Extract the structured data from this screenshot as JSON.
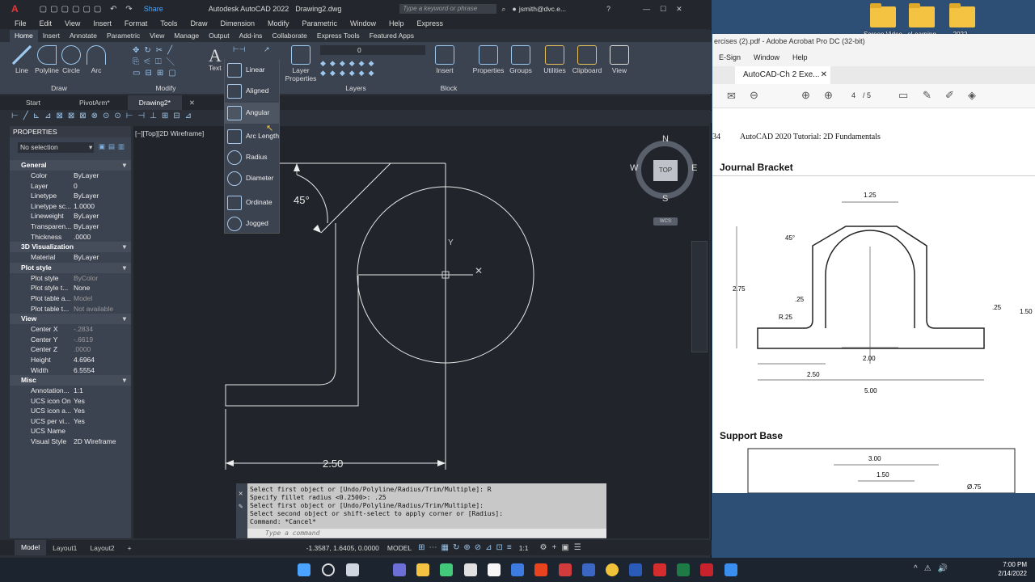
{
  "desktop": {
    "icons": [
      "Screen Video",
      "eLearning",
      "2022 -"
    ]
  },
  "acad": {
    "title": "Autodesk AutoCAD 2022",
    "filename": "Drawing2.dwg",
    "share_label": "Share",
    "search_placeholder": "Type a keyword or phrase",
    "user": "jsmith@dvc.e...",
    "menus": [
      "File",
      "Edit",
      "View",
      "Insert",
      "Format",
      "Tools",
      "Draw",
      "Dimension",
      "Modify",
      "Parametric",
      "Window",
      "Help",
      "Express"
    ],
    "ribbon_tabs": [
      "Home",
      "Insert",
      "Annotate",
      "Parametric",
      "View",
      "Manage",
      "Output",
      "Add-ins",
      "Collaborate",
      "Express Tools",
      "Featured Apps"
    ],
    "draw_tools": [
      "Line",
      "Polyline",
      "Circle",
      "Arc"
    ],
    "group_labels": {
      "draw": "Draw",
      "modify": "Modify",
      "layers": "Layers",
      "block": "Block"
    },
    "text_label": "Text",
    "layer_properties": "Layer Properties",
    "layer_value": "0",
    "right_tools": [
      "Insert",
      "Properties",
      "Groups",
      "Utilities",
      "Clipboard",
      "View"
    ],
    "doc_tabs": [
      "Start",
      "PivotArm*",
      "Drawing2*"
    ],
    "dim_menu": [
      "Linear",
      "Aligned",
      "Angular",
      "Arc Length",
      "Radius",
      "Diameter",
      "Ordinate",
      "Jogged"
    ]
  },
  "props": {
    "header": "PROPERTIES",
    "selection": "No selection",
    "sections": [
      {
        "title": "General",
        "rows": [
          [
            "Color",
            "ByLayer"
          ],
          [
            "Layer",
            "0"
          ],
          [
            "Linetype",
            "ByLayer"
          ],
          [
            "Linetype sc...",
            "1.0000"
          ],
          [
            "Lineweight",
            "ByLayer"
          ],
          [
            "Transparen...",
            "ByLayer"
          ],
          [
            "Thickness",
            ".0000"
          ]
        ]
      },
      {
        "title": "3D Visualization",
        "rows": [
          [
            "Material",
            "ByLayer"
          ]
        ]
      },
      {
        "title": "Plot style",
        "rows": [
          [
            "Plot style",
            "ByColor"
          ],
          [
            "Plot style t...",
            "None"
          ],
          [
            "Plot table a...",
            "Model"
          ],
          [
            "Plot table t...",
            "Not available"
          ]
        ]
      },
      {
        "title": "View",
        "rows": [
          [
            "Center X",
            "-.2834"
          ],
          [
            "Center Y",
            "-.6619"
          ],
          [
            "Center Z",
            ".0000"
          ],
          [
            "Height",
            "4.6964"
          ],
          [
            "Width",
            "6.5554"
          ]
        ]
      },
      {
        "title": "Misc",
        "rows": [
          [
            "Annotation...",
            "1:1"
          ],
          [
            "UCS icon On",
            "Yes"
          ],
          [
            "UCS icon a...",
            "Yes"
          ],
          [
            "UCS per vi...",
            "Yes"
          ],
          [
            "UCS Name",
            ""
          ],
          [
            "Visual Style",
            "2D Wireframe"
          ]
        ]
      }
    ]
  },
  "canvas": {
    "viewport_label": "[−][Top][2D Wireframe]",
    "angle_label": "45°",
    "dim_label": "2.50",
    "viewcube": {
      "n": "N",
      "s": "S",
      "e": "E",
      "w": "W",
      "top": "TOP",
      "wcs": "WCS"
    }
  },
  "command": {
    "history": [
      "Select first object or [Undo/Polyline/Radius/Trim/Multiple]: R",
      "Specify fillet radius <0.2500>: .25",
      "Select first object or [Undo/Polyline/Radius/Trim/Multiple]:",
      "Select second object or shift-select to apply corner or [Radius]:",
      "Command: *Cancel*"
    ],
    "placeholder": "Type a command"
  },
  "status": {
    "tabs": [
      "Model",
      "Layout1",
      "Layout2"
    ],
    "coords": "-1.3587, 1.6405, 0.0000",
    "model": "MODEL",
    "scale": "1:1"
  },
  "pdf": {
    "window_title": "ercises (2).pdf - Adobe Acrobat Pro DC (32-bit)",
    "menus": [
      "E-Sign",
      "Window",
      "Help"
    ],
    "tab": "AutoCAD-Ch 2 Exe...",
    "page_current": "4",
    "page_total": "/ 5",
    "page_header_num": "34",
    "page_header": "AutoCAD 2020 Tutorial: 2D Fundamentals",
    "section1": "Journal Bracket",
    "section2": "Support Base",
    "dims": {
      "d125": "1.25",
      "d45": "45°",
      "d275": "2.75",
      "d25a": ".25",
      "dr25": "R.25",
      "d25b": ".25",
      "d150": "1.50",
      "d200": "2.00",
      "d250": "2.50",
      "d500": "5.00",
      "d300": "3.00",
      "d150b": "1.50",
      "d75": "Ø.75"
    }
  },
  "taskbar": {
    "time": "7:00 PM",
    "date": "2/14/2022"
  }
}
